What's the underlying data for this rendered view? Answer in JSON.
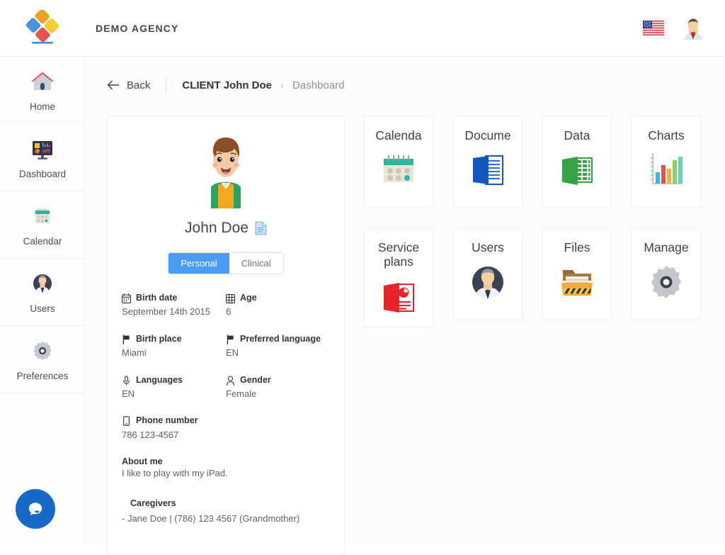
{
  "header": {
    "brand": "DEMO AGENCY",
    "logo_icon": "diamond-blocks-logo",
    "flag_icon": "us-flag-icon",
    "flag_label": "US",
    "user_avatar_icon": "user-avatar-icon",
    "colors": {
      "logo_blue": "#4a93d9",
      "logo_red": "#ea5252",
      "logo_yellow": "#f5cd32",
      "logo_orange": "#f0a022"
    }
  },
  "sidebar": {
    "items": [
      {
        "label": "Home",
        "icon": "home-icon"
      },
      {
        "label": "Dashboard",
        "icon": "dashboard-monitor-icon"
      },
      {
        "label": "Calendar",
        "icon": "calendar-icon"
      },
      {
        "label": "Users",
        "icon": "users-avatar-icon"
      },
      {
        "label": "Preferences",
        "icon": "gear-icon"
      }
    ],
    "chat_icon": "chat-bubble-icon"
  },
  "breadcrumb": {
    "back_label": "Back",
    "back_icon": "arrow-left-icon",
    "client_label": "CLIENT John Doe",
    "separator": "›",
    "current_label": "Dashboard"
  },
  "profile": {
    "avatar_icon": "child-avatar-icon",
    "name": "John Doe",
    "doc_icon": "document-icon",
    "tabs": [
      {
        "label": "Personal",
        "active": true
      },
      {
        "label": "Clinical",
        "active": false
      }
    ],
    "accent_color": "#4a9cf5",
    "fields": [
      {
        "label": "Birth date",
        "value": "September 14th 2015",
        "icon": "calendar-icon"
      },
      {
        "label": "Age",
        "value": "6",
        "icon": "grid-icon"
      },
      {
        "label": "Birth place",
        "value": "Miami",
        "icon": "flag-icon"
      },
      {
        "label": "Preferred language",
        "value": "EN",
        "icon": "flag-icon"
      },
      {
        "label": "Languages",
        "value": "EN",
        "icon": "microphone-icon"
      },
      {
        "label": "Gender",
        "value": "Female",
        "icon": "person-icon"
      },
      {
        "label": "Phone number",
        "value": "786 123-4567",
        "icon": "phone-icon"
      }
    ],
    "about": {
      "title": "About me",
      "text": "I like to play with my iPad."
    },
    "caregivers": {
      "title": "Caregivers",
      "entries": [
        "- Jane Doe | (786) 123 4567 (Grandmother)"
      ]
    }
  },
  "tiles": [
    {
      "label": "Calenda",
      "icon": "calendar-tile-icon"
    },
    {
      "label": "Docume",
      "icon": "documents-tile-icon"
    },
    {
      "label": "Data",
      "icon": "data-tile-icon"
    },
    {
      "label": "Charts",
      "icon": "charts-tile-icon"
    },
    {
      "label": "Service plans",
      "icon": "service-plans-tile-icon"
    },
    {
      "label": "Users",
      "icon": "users-tile-icon"
    },
    {
      "label": "Files",
      "icon": "files-tile-icon"
    },
    {
      "label": "Manage",
      "icon": "manage-gear-tile-icon"
    }
  ]
}
